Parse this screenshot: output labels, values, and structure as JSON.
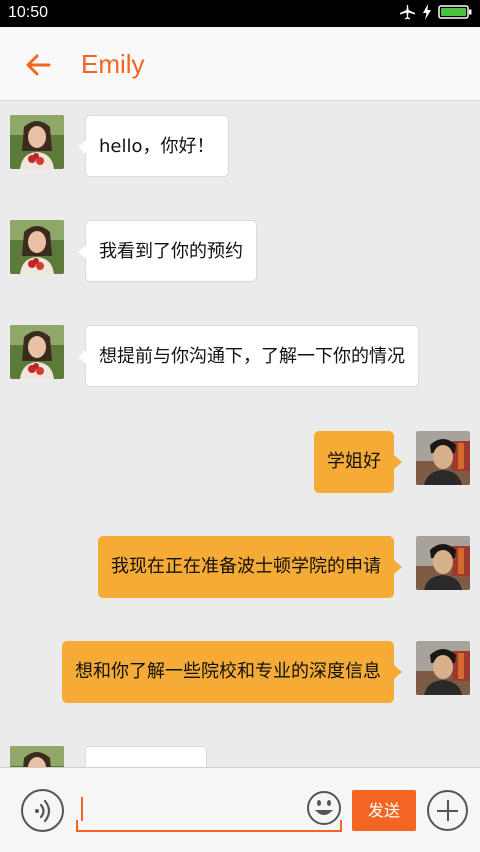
{
  "status_bar": {
    "time": "10:50"
  },
  "header": {
    "title": "Emily",
    "back_icon": "arrow-left-icon"
  },
  "colors": {
    "accent": "#f26522",
    "outgoing_bubble": "#f5ab35",
    "incoming_bubble": "#ffffff",
    "background": "#ebebeb"
  },
  "messages": [
    {
      "direction": "in",
      "text": "hello，你好！"
    },
    {
      "direction": "in",
      "text": "我看到了你的预约"
    },
    {
      "direction": "in",
      "text": "想提前与你沟通下，了解一下你的情况"
    },
    {
      "direction": "out",
      "text": "学姐好"
    },
    {
      "direction": "out",
      "text": "我现在正在准备波士顿学院的申请"
    },
    {
      "direction": "out",
      "text": "想和你了解一些院校和专业的深度信息"
    },
    {
      "direction": "in",
      "text": ""
    }
  ],
  "input_bar": {
    "voice_icon": "voice-icon",
    "input_value": "",
    "emoji_icon": "smiley-icon",
    "send_label": "发送",
    "plus_icon": "plus-icon"
  }
}
